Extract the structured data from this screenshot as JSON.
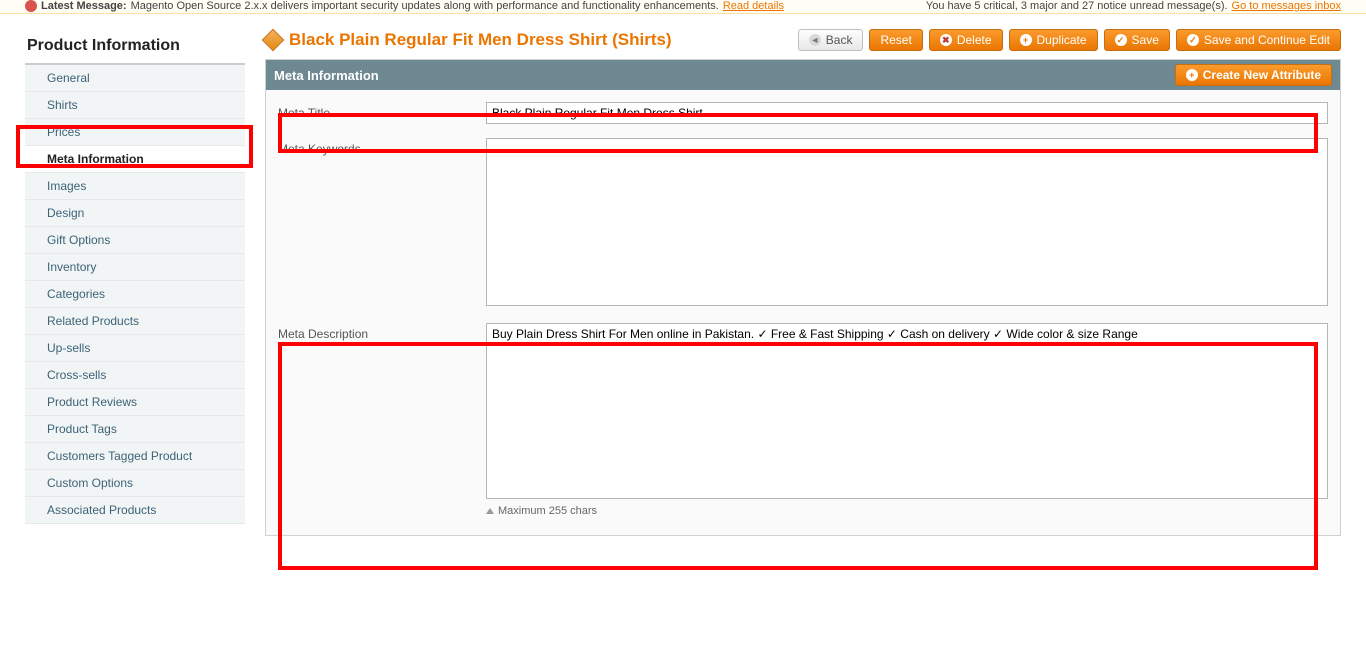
{
  "top": {
    "left_prefix": "Latest Message:",
    "left_msg": "Magento Open Source 2.x.x delivers important security updates along with performance and functionality enhancements.",
    "left_link": "Read details",
    "right_pre": "You have 5 critical, 3 major and 27 notice unread message(s).",
    "right_link": "Go to messages inbox"
  },
  "sidebar": {
    "title": "Product Information",
    "items": [
      {
        "label": "General"
      },
      {
        "label": "Shirts"
      },
      {
        "label": "Prices"
      },
      {
        "label": "Meta Information",
        "active": true
      },
      {
        "label": "Images"
      },
      {
        "label": "Design"
      },
      {
        "label": "Gift Options"
      },
      {
        "label": "Inventory"
      },
      {
        "label": "Categories"
      },
      {
        "label": "Related Products"
      },
      {
        "label": "Up-sells"
      },
      {
        "label": "Cross-sells"
      },
      {
        "label": "Product Reviews"
      },
      {
        "label": "Product Tags"
      },
      {
        "label": "Customers Tagged Product"
      },
      {
        "label": "Custom Options"
      },
      {
        "label": "Associated Products"
      }
    ]
  },
  "header": {
    "title": "Black Plain Regular Fit Men Dress Shirt (Shirts)",
    "buttons": {
      "back": "Back",
      "reset": "Reset",
      "delete": "Delete",
      "duplicate": "Duplicate",
      "save": "Save",
      "save_continue": "Save and Continue Edit"
    }
  },
  "section": {
    "title": "Meta Information",
    "create_attr": "Create New Attribute",
    "fields": {
      "meta_title": {
        "label": "Meta Title",
        "value": "Black Plain Regular Fit Men Dress Shirt"
      },
      "meta_keywords": {
        "label": "Meta Keywords",
        "value": ""
      },
      "meta_description": {
        "label": "Meta Description",
        "value": "Buy Plain Dress Shirt For Men online in Pakistan. ✓ Free & Fast Shipping ✓ Cash on delivery ✓ Wide color & size Range",
        "helper": "Maximum 255 chars"
      }
    }
  }
}
